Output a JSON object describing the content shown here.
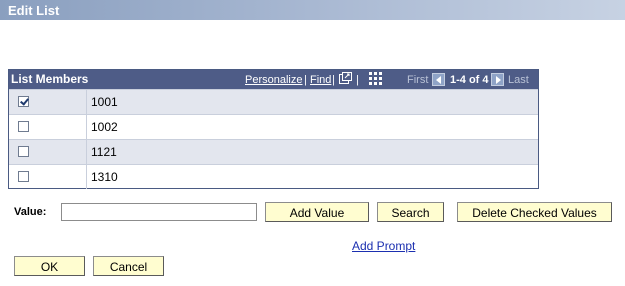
{
  "window": {
    "title": "Edit List"
  },
  "grid": {
    "title": "List Members",
    "nav": {
      "personalize": "Personalize",
      "separator": "|",
      "find": "Find",
      "first": "First",
      "range": "1-4 of 4",
      "last": "Last"
    },
    "rows": [
      {
        "value": "1001",
        "checked": true
      },
      {
        "value": "1002",
        "checked": false
      },
      {
        "value": "1121",
        "checked": false
      },
      {
        "value": "1310",
        "checked": false
      }
    ]
  },
  "form": {
    "value_label": "Value:",
    "value_input": "",
    "add_value": "Add Value",
    "search": "Search",
    "delete_checked": "Delete Checked Values",
    "add_prompt": "Add Prompt",
    "ok": "OK",
    "cancel": "Cancel"
  }
}
